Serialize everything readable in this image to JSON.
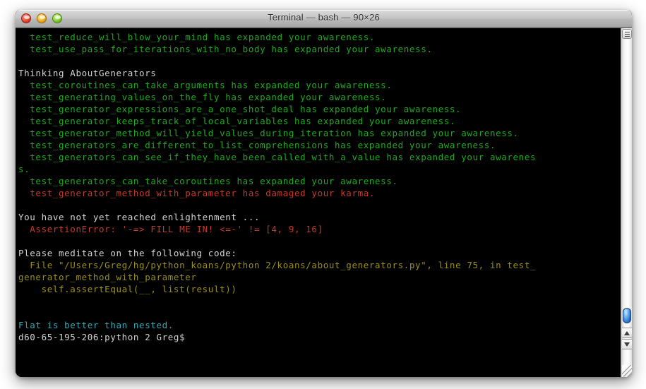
{
  "window": {
    "title": "Terminal — bash — 90×26",
    "buttons": {
      "close": "close",
      "minimize": "minimize",
      "zoom": "zoom"
    }
  },
  "colors": {
    "green": "#1faa1f",
    "red": "#c33b2a",
    "yellow": "#9a9017",
    "cyan": "#35a8b8",
    "white": "#d4d4d4",
    "background": "#000000"
  },
  "terminal": {
    "cols": 90,
    "rows": 26,
    "lines": [
      {
        "text": "  test_reduce_will_blow_your_mind has expanded your awareness.",
        "color": "green"
      },
      {
        "text": "  test_use_pass_for_iterations_with_no_body has expanded your awareness.",
        "color": "green"
      },
      {
        "text": "",
        "color": "white"
      },
      {
        "text": "Thinking AboutGenerators",
        "color": "white"
      },
      {
        "text": "  test_coroutines_can_take_arguments has expanded your awareness.",
        "color": "green"
      },
      {
        "text": "  test_generating_values_on_the_fly has expanded your awareness.",
        "color": "green"
      },
      {
        "text": "  test_generator_expressions_are_a_one_shot_deal has expanded your awareness.",
        "color": "green"
      },
      {
        "text": "  test_generator_keeps_track_of_local_variables has expanded your awareness.",
        "color": "green"
      },
      {
        "text": "  test_generator_method_will_yield_values_during_iteration has expanded your awareness.",
        "color": "green"
      },
      {
        "text": "  test_generators_are_different_to_list_comprehensions has expanded your awareness.",
        "color": "green"
      },
      {
        "text": "  test_generators_can_see_if_they_have_been_called_with_a_value has expanded your awarenes",
        "color": "green"
      },
      {
        "text": "s.",
        "color": "green"
      },
      {
        "text": "  test_generators_can_take_coroutines has expanded your awareness.",
        "color": "green"
      },
      {
        "text": "  test_generator_method_with_parameter has damaged your karma.",
        "color": "red"
      },
      {
        "text": "",
        "color": "white"
      },
      {
        "text": "You have not yet reached enlightenment ...",
        "color": "white"
      },
      {
        "text": "  AssertionError: '-=> FILL ME IN! <=-' != [4, 9, 16]",
        "color": "red"
      },
      {
        "text": "",
        "color": "white"
      },
      {
        "text": "Please meditate on the following code:",
        "color": "white"
      },
      {
        "text": "  File \"/Users/Greg/hg/python_koans/python 2/koans/about_generators.py\", line 75, in test_",
        "color": "yellow"
      },
      {
        "text": "generator_method_with_parameter",
        "color": "yellow"
      },
      {
        "text": "    self.assertEqual(__, list(result))",
        "color": "yellow"
      },
      {
        "text": "",
        "color": "white"
      },
      {
        "text": "",
        "color": "white"
      },
      {
        "text": "Flat is better than nested.",
        "color": "cyan"
      },
      {
        "text": "d60-65-195-206:python 2 Greg$",
        "color": "white"
      }
    ]
  },
  "scrollbar": {
    "top_button": "scroll-options",
    "up_arrow": "▲",
    "down_arrow": "▼",
    "grip": "resize-grip"
  }
}
